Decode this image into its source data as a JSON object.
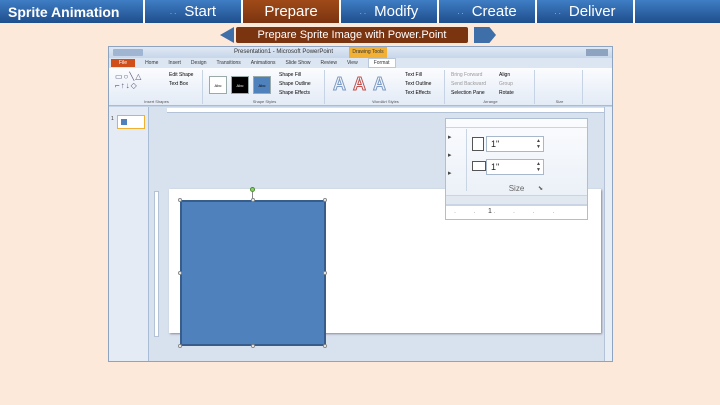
{
  "nav": {
    "title": "Sprite Animation",
    "tabs": [
      {
        "label": "Start"
      },
      {
        "label": "Prepare"
      },
      {
        "label": "Modify"
      },
      {
        "label": "Create"
      },
      {
        "label": "Deliver"
      }
    ],
    "active_tab": "Prepare"
  },
  "substep": {
    "label": "Prepare Sprite Image with Power.Point"
  },
  "ppt": {
    "window_title": "Presentation1 - Microsoft PowerPoint",
    "contextual_tab": "Drawing Tools",
    "ribbon_tabs": [
      "File",
      "Home",
      "Insert",
      "Design",
      "Transitions",
      "Animations",
      "Slide Show",
      "Review",
      "View",
      "Format"
    ],
    "active_ribbon_tab": "Format",
    "groups": {
      "insert_shapes": "Insert Shapes",
      "shape_styles": "Shape Styles",
      "wordart_styles": "WordArt Styles",
      "arrange": "Arrange",
      "size": "Size"
    },
    "buttons": {
      "edit_shape": "Edit Shape",
      "text_box": "Text Box",
      "shape_fill": "Shape Fill",
      "shape_outline": "Shape Outline",
      "shape_effects": "Shape Effects",
      "text_fill": "Text Fill",
      "text_outline": "Text Outline",
      "text_effects": "Text Effects",
      "bring_forward": "Bring Forward",
      "send_backward": "Send Backward",
      "selection_pane": "Selection Pane",
      "align": "Align",
      "group": "Group",
      "rotate": "Rotate"
    },
    "swatches": [
      "Abc",
      "Abc",
      "Abc"
    ],
    "slide_number": "1"
  },
  "callout": {
    "height_value": "1\"",
    "width_value": "1\"",
    "size_label": "Size",
    "ruler_number": "1"
  },
  "colors": {
    "nav_blue": "#2d66ab",
    "nav_active": "#8b3d12",
    "shape_fill": "#4f81bd",
    "background": "#fde9d9"
  }
}
